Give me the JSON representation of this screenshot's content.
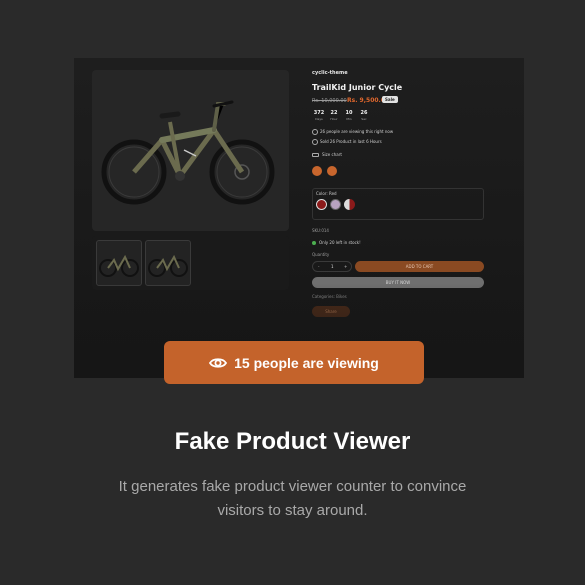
{
  "preview": {
    "brand": "cyclic-theme",
    "product_title": "TrailKid Junior Cycle",
    "price_old": "Rs. 10,000.00",
    "price_new": "Rs. 9,500.00",
    "sale_badge": "Sale",
    "countdown": [
      {
        "value": "372",
        "label": "Days"
      },
      {
        "value": "22",
        "label": "Hour"
      },
      {
        "value": "10",
        "label": "Min"
      },
      {
        "value": "26",
        "label": "Sec"
      }
    ],
    "viewing_note": "26 people are viewing this right now",
    "sold_note": "Sold 26 Product in last 6 Hours",
    "size_chart": "Size chart",
    "color_label": "Color: Red",
    "sku": "SKU:014",
    "stock_note": "Only 20 left in stock!",
    "quantity_label": "Quantity",
    "qty_value": "1",
    "qty_minus": "-",
    "qty_plus": "+",
    "add_to_cart": "ADD TO CART",
    "buy_now": "BUY IT NOW",
    "categories": "Categories:  Bikes",
    "share": "Share"
  },
  "viewer_button": {
    "label": "15 people are viewing",
    "icon": "eye-icon"
  },
  "feature": {
    "title": "Fake Product Viewer",
    "description": "It generates fake product viewer counter to convince visitors to stay around."
  },
  "colors": {
    "accent": "#c4632b",
    "background": "#2a2a2a"
  }
}
